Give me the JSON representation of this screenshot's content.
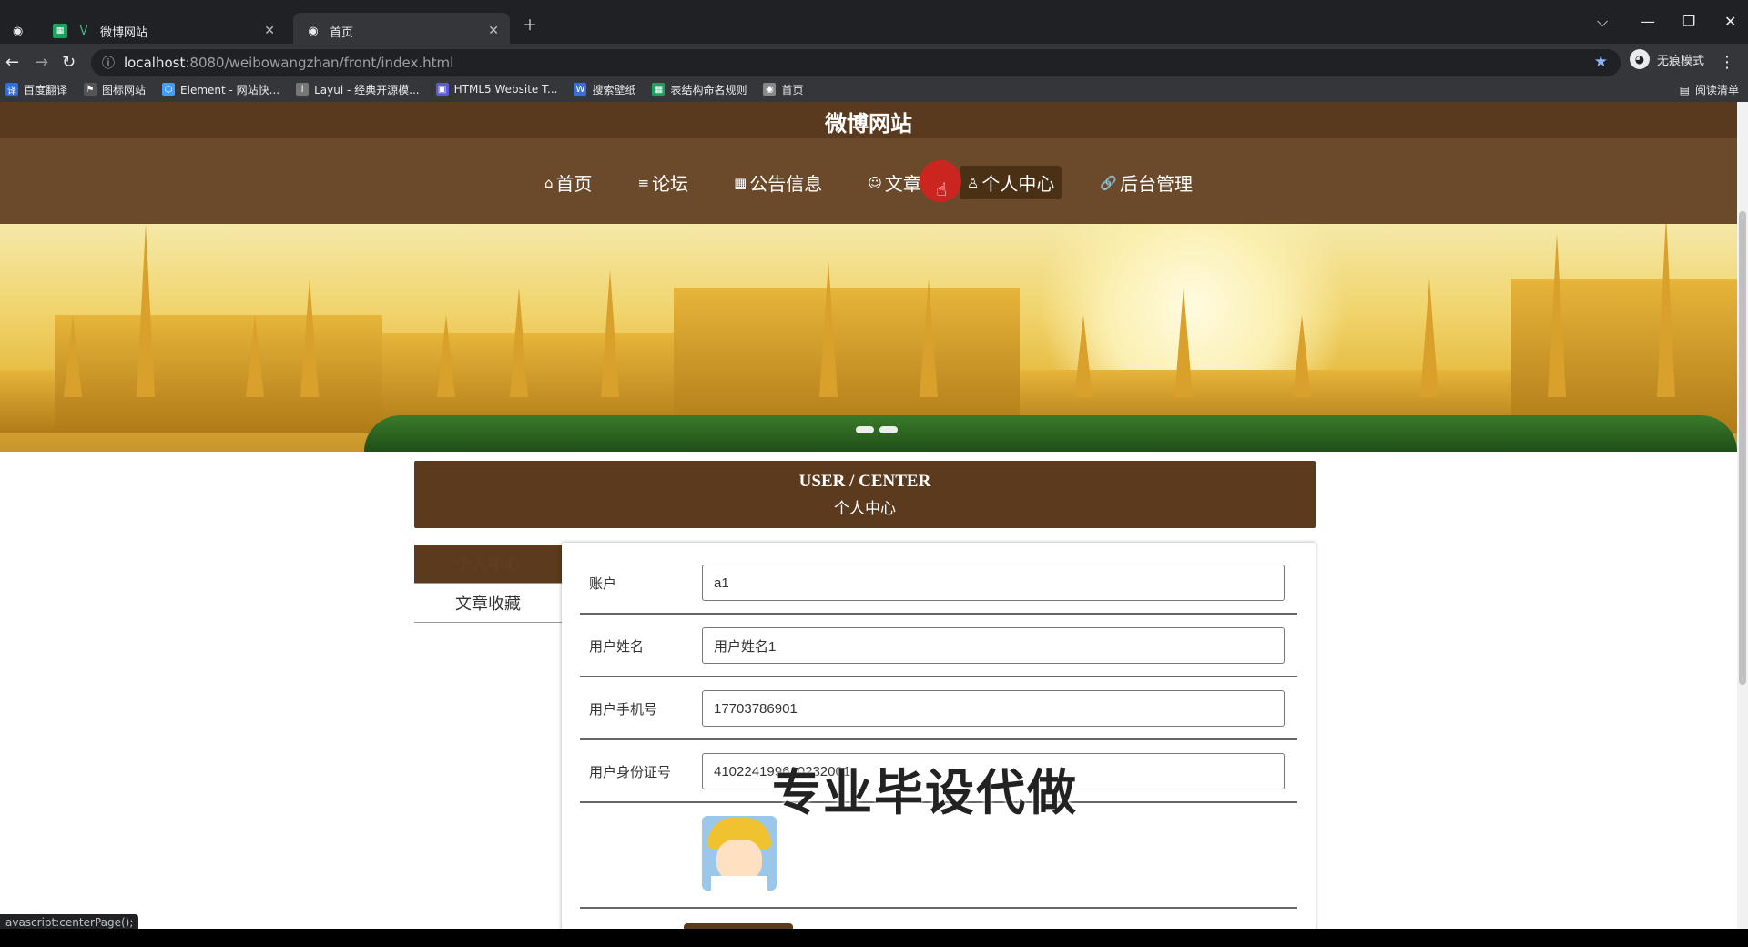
{
  "browser": {
    "tabs": [
      {
        "label": "",
        "icon": "app-icon"
      },
      {
        "label": "微博网站",
        "icon": "vue-icon"
      },
      {
        "label": "首页",
        "icon": "globe-icon"
      }
    ],
    "url_host": "localhost",
    "url_rest": ":8080/weibowangzhan/front/index.html",
    "incognito_label": "无痕模式",
    "bookmarks": [
      {
        "label": "百度翻译",
        "color": "#2f6ee0"
      },
      {
        "label": "图标网站",
        "color": "#333333"
      },
      {
        "label": "Element - 网站快...",
        "color": "#409eff"
      },
      {
        "label": "Layui - 经典开源模...",
        "color": "#777777"
      },
      {
        "label": "HTML5 Website T...",
        "color": "#5b5bd6"
      },
      {
        "label": "搜索壁纸",
        "color": "#3a6fd8"
      },
      {
        "label": "表结构命名规则",
        "color": "#1aa260"
      },
      {
        "label": "首页",
        "color": "#888888"
      }
    ],
    "reading_list": "阅读清单",
    "status_text": "avascript:centerPage();"
  },
  "site": {
    "title": "微博网站",
    "nav": [
      {
        "label": "首页",
        "icon": "⌂"
      },
      {
        "label": "论坛",
        "icon": "≡"
      },
      {
        "label": "公告信息",
        "icon": "▦"
      },
      {
        "label": "文章",
        "icon": "☺"
      },
      {
        "label": "个人中心",
        "icon": "♙"
      },
      {
        "label": "后台管理",
        "icon": "🔗"
      }
    ],
    "active_nav": 4
  },
  "user_center": {
    "title_en": "USER / CENTER",
    "title_cn": "个人中心",
    "sidebar": [
      {
        "label": "个人中心"
      },
      {
        "label": "文章收藏"
      }
    ],
    "fields": [
      {
        "label": "账户",
        "value": "a1"
      },
      {
        "label": "用户姓名",
        "value": "用户姓名1"
      },
      {
        "label": "用户手机号",
        "value": "17703786901"
      },
      {
        "label": "用户身份证号",
        "value": "410224199610232001"
      }
    ]
  },
  "overlay": {
    "watermark": "专业毕设代做"
  },
  "colors": {
    "brand_brown": "#5c3a1d",
    "header_brown": "#6b4a2b"
  }
}
